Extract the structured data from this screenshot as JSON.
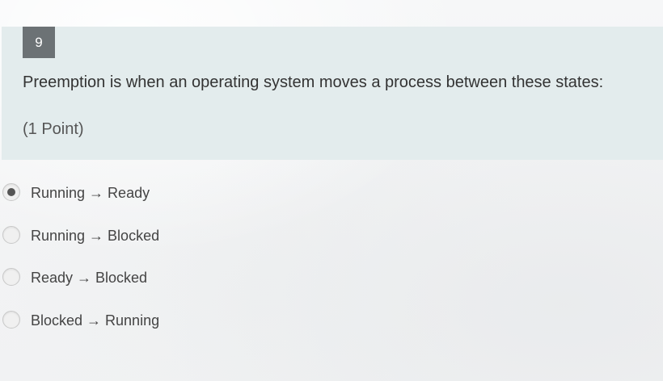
{
  "question": {
    "number": "9",
    "text": "Preemption is when an operating system moves a process between these states:",
    "points": "(1 Point)"
  },
  "options": [
    {
      "label": "Running → Ready",
      "selected": true
    },
    {
      "label": "Running → Blocked",
      "selected": false
    },
    {
      "label": "Ready → Blocked",
      "selected": false
    },
    {
      "label": "Blocked → Running",
      "selected": false
    }
  ],
  "colors": {
    "card_background": "#e3eced",
    "number_badge": "#6c7275",
    "text": "#333333"
  }
}
